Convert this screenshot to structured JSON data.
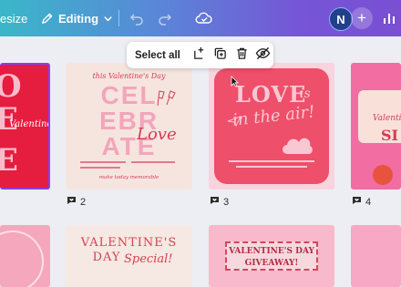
{
  "header": {
    "resize_label": "esize",
    "editing_label": "Editing",
    "avatar_initial": "N"
  },
  "selection_toolbar": {
    "select_all_label": "Select all"
  },
  "pages": {
    "card1": {
      "lines": [
        "O",
        "E",
        "E"
      ],
      "subtitle": "Valentine's"
    },
    "card2": {
      "page_number": "2",
      "top_text": "this Valentine's Day",
      "big_lines": [
        "CEL",
        "EBR",
        "ATE"
      ],
      "script_text": "Love",
      "footer_text": "make today memorable"
    },
    "card3": {
      "page_number": "3",
      "love_text": "LOVE",
      "is_text": "is",
      "air_text": "in the air!"
    },
    "card4": {
      "page_number": "4",
      "small_text": "Valentin",
      "big_text": "SI"
    },
    "card6": {
      "line1": "VALENTINE'S",
      "line2": "DAY",
      "script_text": "Special!"
    },
    "card7": {
      "banner_text": "VALENTINE'S DAY GIVEAWAY!"
    }
  },
  "colors": {
    "accent_purple": "#8b3df0",
    "primary_red": "#e51d3f",
    "pink": "#f26da1"
  }
}
